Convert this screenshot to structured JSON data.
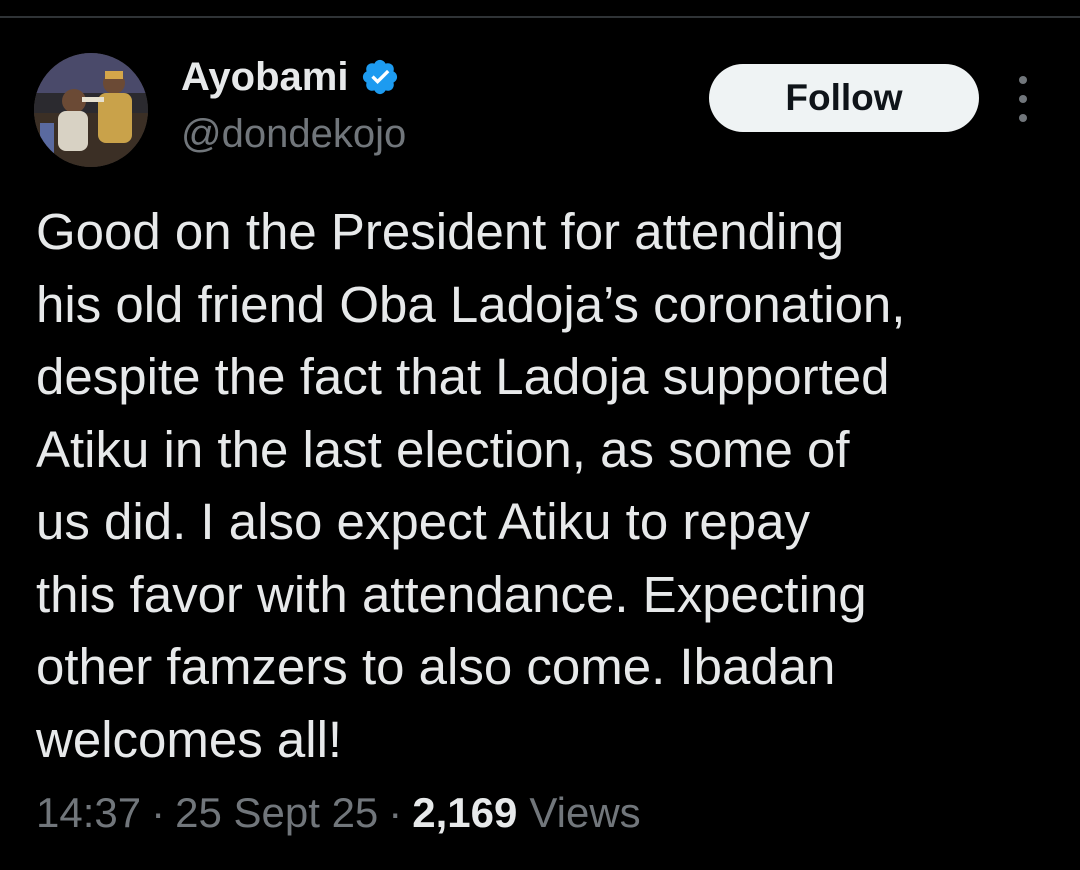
{
  "colors": {
    "background": "#000000",
    "text_primary": "#e7e9ea",
    "text_secondary": "#71767b",
    "verified_blue": "#1d9bf0",
    "follow_button_bg": "#eff3f4",
    "follow_button_text": "#0f1419"
  },
  "author": {
    "display_name": "Ayobami",
    "handle": "@dondekojo",
    "verified": true,
    "avatar_icon": "profile-photo"
  },
  "actions": {
    "follow_label": "Follow",
    "more_icon": "more-vertical-icon"
  },
  "tweet": {
    "lines": [
      "Good on the President for attending",
      "his old friend Oba Ladoja’s coronation,",
      "despite the fact that Ladoja supported",
      "Atiku in the last election, as some of",
      "us did. I also expect Atiku to repay",
      "this favor with attendance. Expecting",
      "other famzers to also come. Ibadan",
      "welcomes all!"
    ]
  },
  "meta": {
    "time": "14:37",
    "separator": "·",
    "date": "25 Sept 25",
    "views_count": "2,169",
    "views_label": "Views"
  }
}
